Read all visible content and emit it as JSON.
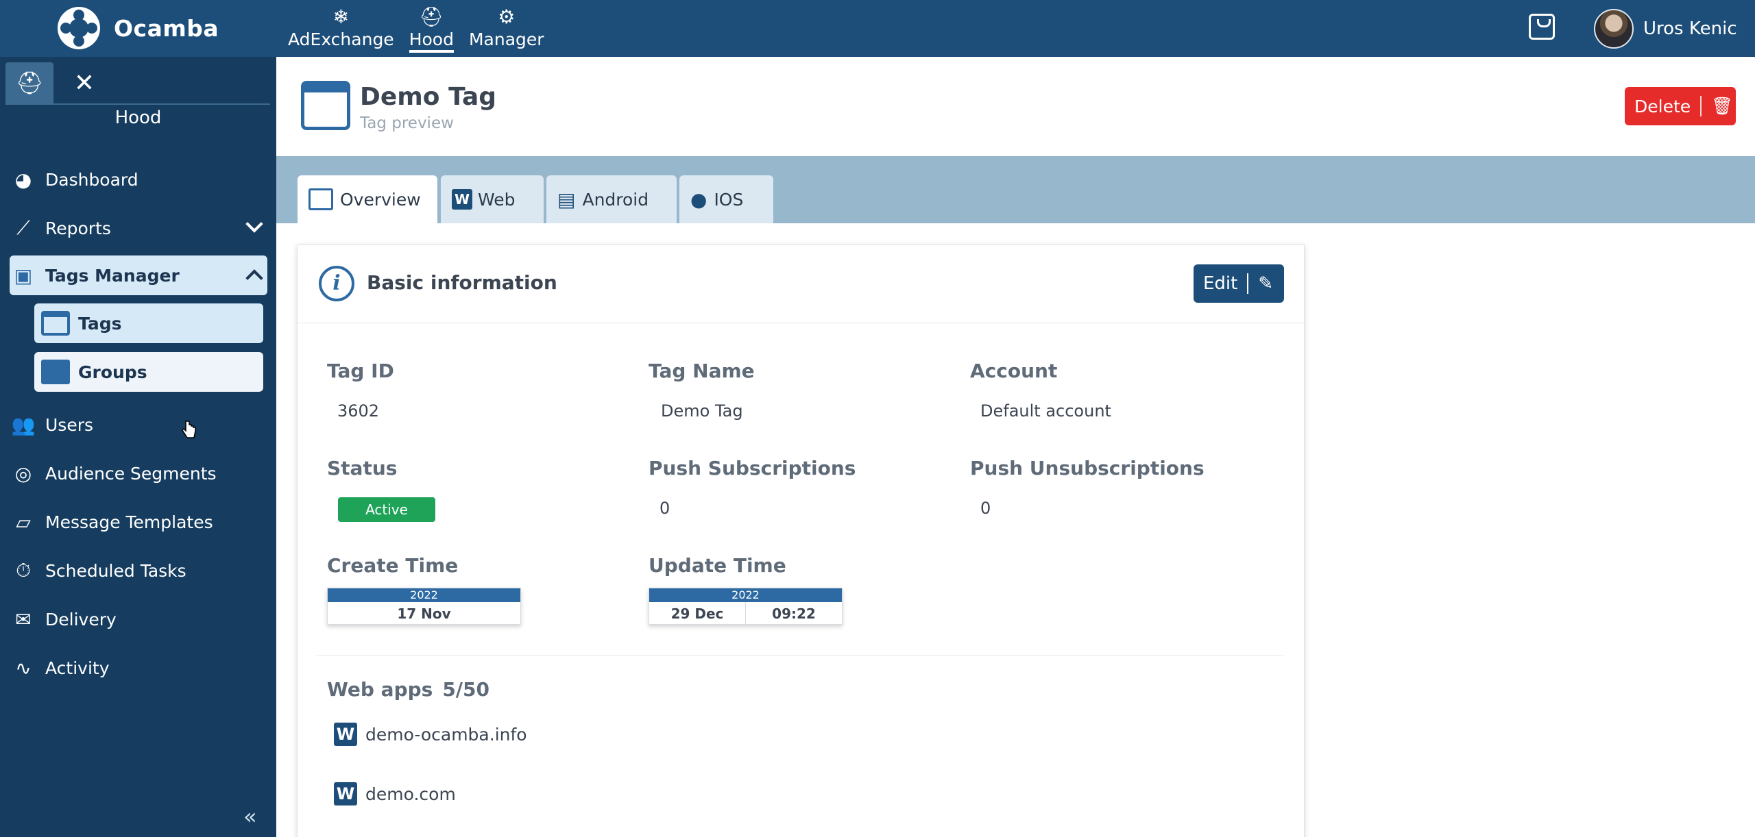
{
  "app": {
    "name": "Ocamba"
  },
  "topnav": [
    {
      "label": "AdExchange",
      "icon": "adexchange-icon"
    },
    {
      "label": "Hood",
      "icon": "hood-icon",
      "active": true
    },
    {
      "label": "Manager",
      "icon": "manager-icon"
    }
  ],
  "user": {
    "name": "Uros Kenic"
  },
  "sidebar": {
    "title": "Hood",
    "items": [
      {
        "label": "Dashboard",
        "icon": "dashboard-icon"
      },
      {
        "label": "Reports",
        "icon": "reports-icon"
      },
      {
        "label": "Tags Manager",
        "icon": "tags-manager-icon",
        "expanded": true
      },
      {
        "label": "Tags",
        "icon": "tag-window-icon",
        "selected": true
      },
      {
        "label": "Groups",
        "icon": "folder-icon"
      },
      {
        "label": "Users",
        "icon": "users-icon"
      },
      {
        "label": "Audience Segments",
        "icon": "audience-icon"
      },
      {
        "label": "Message Templates",
        "icon": "message-templates-icon"
      },
      {
        "label": "Scheduled Tasks",
        "icon": "scheduled-tasks-icon"
      },
      {
        "label": "Delivery",
        "icon": "delivery-icon"
      },
      {
        "label": "Activity",
        "icon": "activity-icon"
      }
    ],
    "collapse_glyph": "«"
  },
  "page": {
    "title": "Demo Tag",
    "subtitle": "Tag preview",
    "delete_label": "Delete"
  },
  "tabs": [
    {
      "label": "Overview",
      "active": true
    },
    {
      "label": "Web"
    },
    {
      "label": "Android"
    },
    {
      "label": "IOS"
    }
  ],
  "card": {
    "title": "Basic information",
    "edit_label": "Edit",
    "fields": {
      "tag_id_label": "Tag ID",
      "tag_id": "3602",
      "tag_name_label": "Tag Name",
      "tag_name": "Demo Tag",
      "account_label": "Account",
      "account": "Default account",
      "status_label": "Status",
      "status": "Active",
      "push_sub_label": "Push Subscriptions",
      "push_sub": "0",
      "push_unsub_label": "Push Unsubscriptions",
      "push_unsub": "0",
      "create_label": "Create Time",
      "create_year": "2022",
      "create_date": "17 Nov",
      "update_label": "Update Time",
      "update_year": "2022",
      "update_date": "29 Dec",
      "update_time": "09:22"
    },
    "webapps_label": "Web apps",
    "webapps_count": "5/50",
    "webapps": [
      "demo-ocamba.info",
      "demo.com"
    ]
  },
  "colors": {
    "brand": "#1d4e79",
    "sidebar": "#163d5f",
    "delete": "#e62b2b",
    "status_active": "#1ea359"
  }
}
